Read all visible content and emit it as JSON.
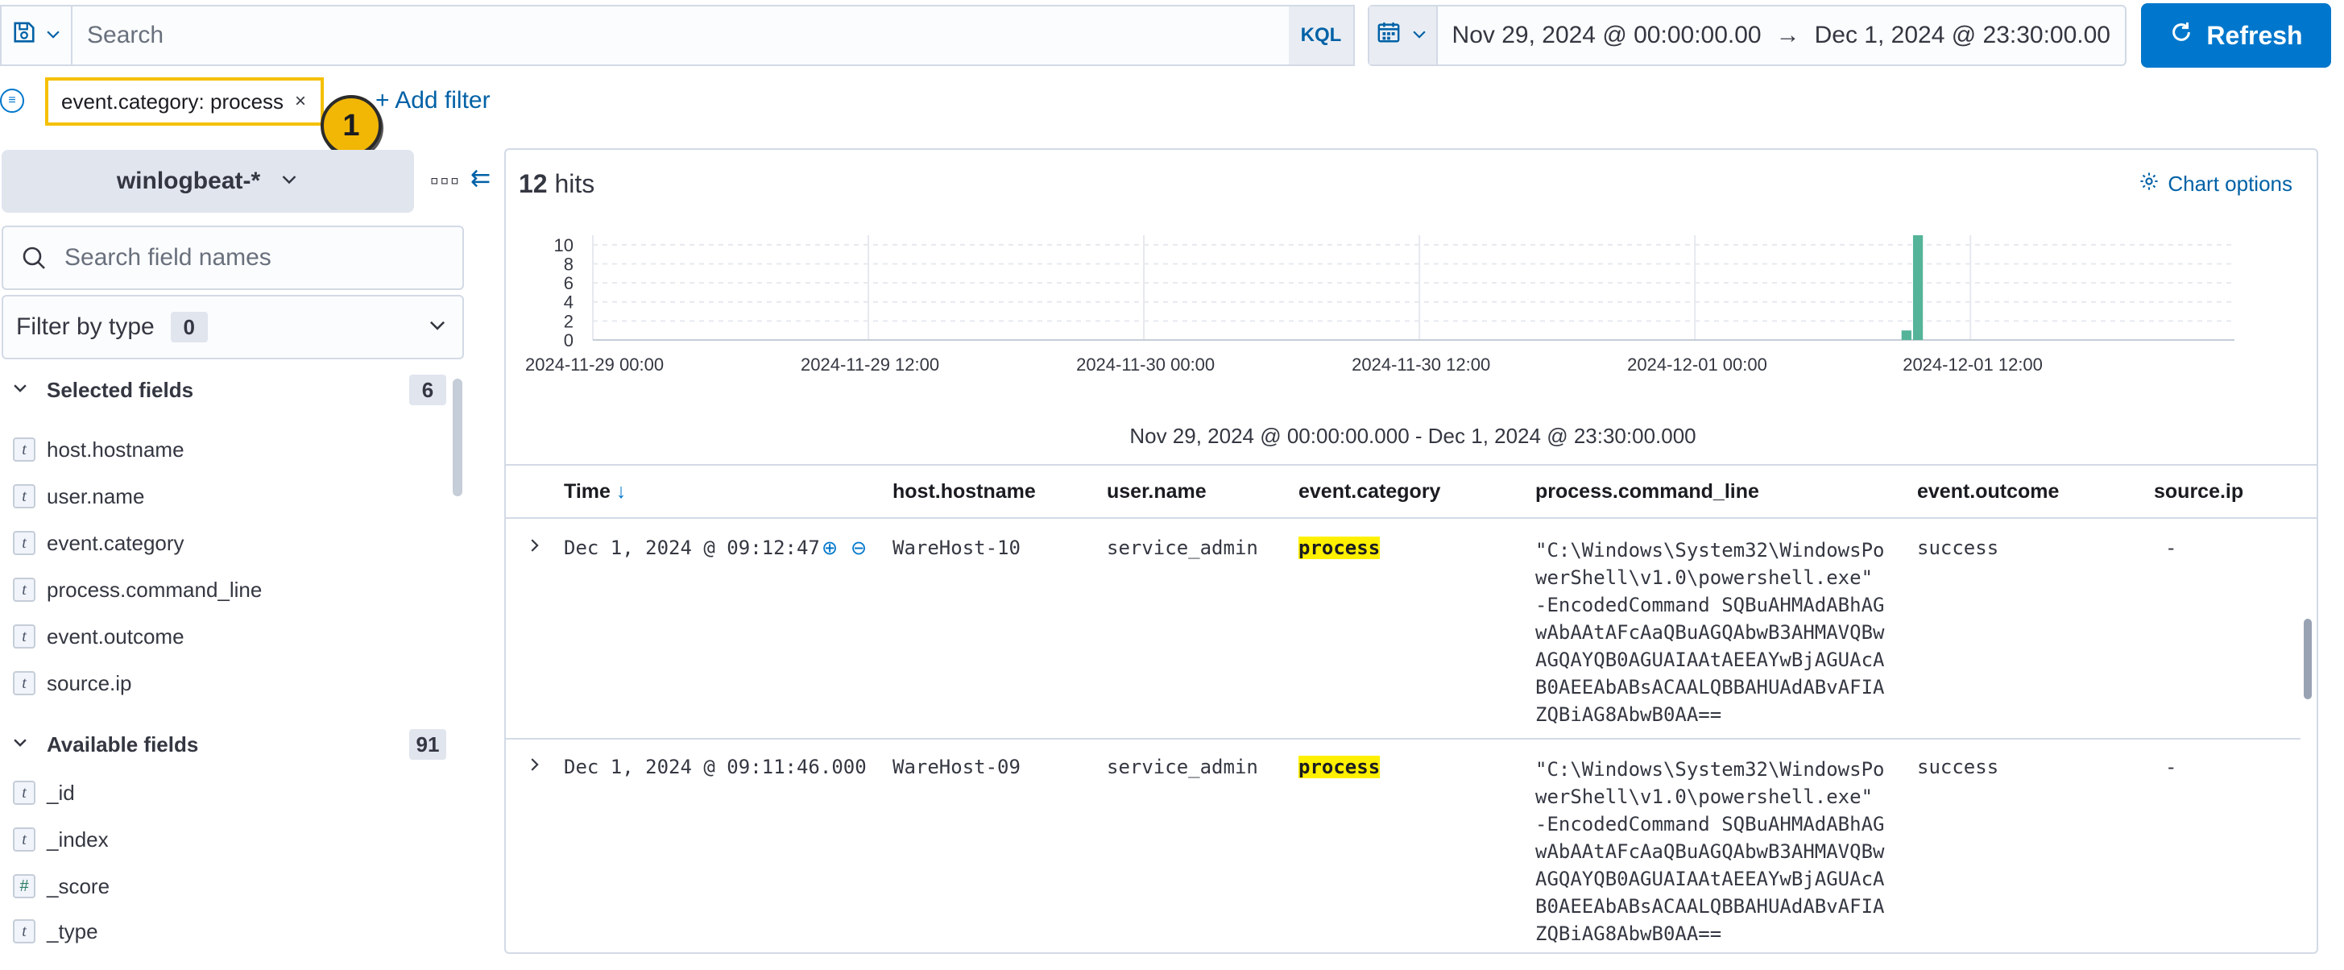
{
  "toolbar": {
    "search_placeholder": "Search",
    "query_language": "KQL",
    "date_start": "Nov 29, 2024 @ 00:00:00.00",
    "date_arrow": "→",
    "date_end": "Dec 1, 2024 @ 23:30:00.00",
    "refresh_label": "Refresh"
  },
  "filters": {
    "pill_label": "event.category: process",
    "pill_close": "×",
    "step_badge": "1",
    "add_filter_label": "+ Add filter"
  },
  "sidebar": {
    "index_pattern": "winlogbeat-*",
    "field_search_placeholder": "Search field names",
    "filter_by_type_label": "Filter by type",
    "filter_by_type_count": "0",
    "selected_section": {
      "label": "Selected fields",
      "count": "6"
    },
    "selected_fields": [
      {
        "type": "t",
        "name": "host.hostname"
      },
      {
        "type": "t",
        "name": "user.name"
      },
      {
        "type": "t",
        "name": "event.category"
      },
      {
        "type": "t",
        "name": "process.command_line"
      },
      {
        "type": "t",
        "name": "event.outcome"
      },
      {
        "type": "t",
        "name": "source.ip"
      }
    ],
    "available_section": {
      "label": "Available fields",
      "count": "91"
    },
    "available_fields": [
      {
        "type": "t",
        "name": "_id"
      },
      {
        "type": "t",
        "name": "_index"
      },
      {
        "type": "#",
        "name": "_score"
      },
      {
        "type": "t",
        "name": "_type"
      }
    ]
  },
  "main": {
    "hits_count": "12",
    "hits_label": "hits",
    "chart_options_label": "Chart options",
    "time_range_label": "Nov 29, 2024 @ 00:00:00.000 - Dec 1, 2024 @ 23:30:00.000",
    "columns": [
      "Time",
      "host.hostname",
      "user.name",
      "event.category",
      "process.command_line",
      "event.outcome",
      "source.ip"
    ],
    "sort_indicator": "↓",
    "rows": [
      {
        "time": "Dec 1, 2024 @ 09:12:47",
        "host": "WareHost-10",
        "user": "service_admin",
        "category": "process",
        "command_line": "\"C:\\Windows\\System32\\WindowsPowerShell\\v1.0\\powershell.exe\" -EncodedCommand SQBuAHMAdABhAGwAbAAtAFcAaQBuAGQAbwB3AHMAVQBwAGQAYQB0AGUAIAAtAEEAYwBjAGUAcAB0AEEAbABsACAALQBBAHUAdABvAFIAZQBiAG8AbwB0AA==",
        "outcome": "success",
        "source_ip": "-"
      },
      {
        "time": "Dec 1, 2024 @ 09:11:46.000",
        "host": "WareHost-09",
        "user": "service_admin",
        "category": "process",
        "command_line": "\"C:\\Windows\\System32\\WindowsPowerShell\\v1.0\\powershell.exe\" -EncodedCommand SQBuAHMAdABhAGwAbAAtAFcAaQBuAGQAbwB3AHMAVQBwAGQAYQB0AGUAIAAtAEEAYwBjAGUAcAB0AEEAbABsACAALQBBAHUAdABvAFIAZQBiAG8AbwB0AA==",
        "outcome": "success",
        "source_ip": "-"
      }
    ]
  },
  "colors": {
    "accent": "#0077cc",
    "bar": "#54b399",
    "highlight": "#fff000",
    "callout": "#f2b705"
  },
  "chart_data": {
    "type": "bar",
    "x_tick_labels": [
      "2024-11-29 00:00",
      "2024-11-29 12:00",
      "2024-11-30 00:00",
      "2024-11-30 12:00",
      "2024-12-01 00:00",
      "2024-12-01 12:00"
    ],
    "y_tick_labels": [
      "0",
      "2",
      "4",
      "6",
      "8",
      "10"
    ],
    "ylim": [
      0,
      11
    ],
    "xlim": [
      "2024-11-29 00:00",
      "2024-12-01 23:30"
    ],
    "bars": [
      {
        "x": "2024-12-01 09:00",
        "value": 1
      },
      {
        "x": "2024-12-01 09:30",
        "value": 11
      }
    ],
    "grid": true
  }
}
